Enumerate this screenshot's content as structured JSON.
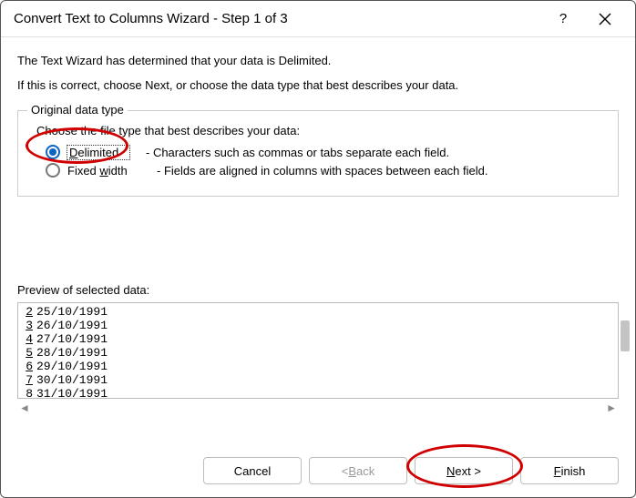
{
  "titlebar": {
    "title": "Convert Text to Columns Wizard - Step 1 of 3"
  },
  "intro": {
    "line1": "The Text Wizard has determined that your data is Delimited.",
    "line2": "If this is correct, choose Next, or choose the data type that best describes your data."
  },
  "fieldset": {
    "legend": "Original data type",
    "prompt": "Choose the file type that best describes your data:",
    "options": {
      "delimited": {
        "accel": "D",
        "rest": "elimited",
        "desc": "- Characters such as commas or tabs separate each field."
      },
      "fixed": {
        "pre": "Fixed ",
        "accel": "w",
        "post": "idth",
        "desc": "- Fields are aligned in columns with spaces between each field."
      }
    }
  },
  "preview": {
    "label": "Preview of selected data:",
    "rows": [
      {
        "idx": "2",
        "val": "25/10/1991"
      },
      {
        "idx": "3",
        "val": "26/10/1991"
      },
      {
        "idx": "4",
        "val": "27/10/1991"
      },
      {
        "idx": "5",
        "val": "28/10/1991"
      },
      {
        "idx": "6",
        "val": "29/10/1991"
      },
      {
        "idx": "7",
        "val": "30/10/1991"
      },
      {
        "idx": "8",
        "val": "31/10/1991"
      }
    ]
  },
  "buttons": {
    "cancel": "Cancel",
    "back_lt": "< ",
    "back_accel": "B",
    "back_rest": "ack",
    "next_accel": "N",
    "next_rest": "ext >",
    "finish_accel": "F",
    "finish_rest": "inish"
  },
  "help_glyph": "?"
}
